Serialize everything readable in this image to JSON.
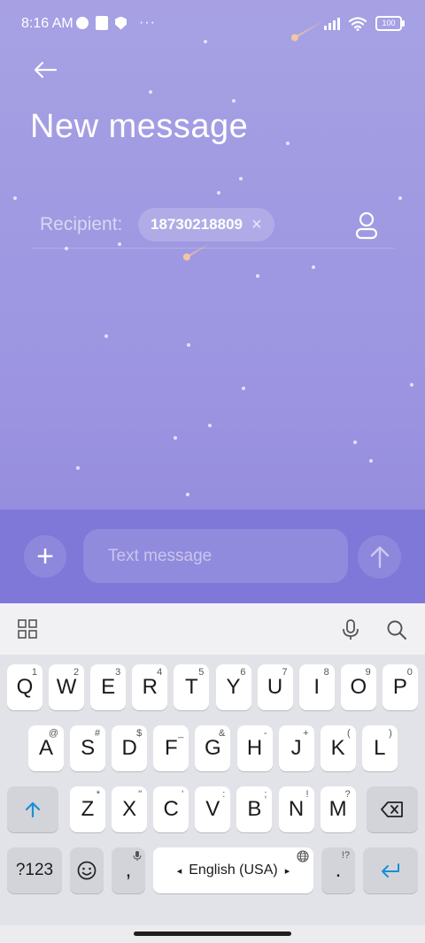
{
  "status_bar": {
    "time": "8:16 AM",
    "battery": "100"
  },
  "header": {
    "title": "New message"
  },
  "recipient": {
    "label": "Recipient:",
    "chip": "18730218809",
    "chip_remove": "×"
  },
  "compose": {
    "placeholder": "Text message",
    "add": "+"
  },
  "keyboard": {
    "row1": [
      {
        "k": "Q",
        "s": "1"
      },
      {
        "k": "W",
        "s": "2"
      },
      {
        "k": "E",
        "s": "3"
      },
      {
        "k": "R",
        "s": "4"
      },
      {
        "k": "T",
        "s": "5"
      },
      {
        "k": "Y",
        "s": "6"
      },
      {
        "k": "U",
        "s": "7"
      },
      {
        "k": "I",
        "s": "8"
      },
      {
        "k": "O",
        "s": "9"
      },
      {
        "k": "P",
        "s": "0"
      }
    ],
    "row2": [
      {
        "k": "A",
        "s": "@"
      },
      {
        "k": "S",
        "s": "#"
      },
      {
        "k": "D",
        "s": "$"
      },
      {
        "k": "F",
        "s": "_"
      },
      {
        "k": "G",
        "s": "&"
      },
      {
        "k": "H",
        "s": "-"
      },
      {
        "k": "J",
        "s": "+"
      },
      {
        "k": "K",
        "s": "("
      },
      {
        "k": "L",
        "s": ")"
      }
    ],
    "row3": [
      {
        "k": "Z",
        "s": "*"
      },
      {
        "k": "X",
        "s": "\""
      },
      {
        "k": "C",
        "s": "'"
      },
      {
        "k": "V",
        "s": ":"
      },
      {
        "k": "B",
        "s": ";"
      },
      {
        "k": "N",
        "s": "!"
      },
      {
        "k": "M",
        "s": "?"
      }
    ],
    "symbols_label": "?123",
    "comma": ",",
    "space_label": "English (USA)",
    "period": ".",
    "period_sup": "!?"
  },
  "colors": {
    "accent": "#1a8fd6",
    "background_top": "#a7a1e4",
    "compose_bar": "#7f78d8"
  }
}
